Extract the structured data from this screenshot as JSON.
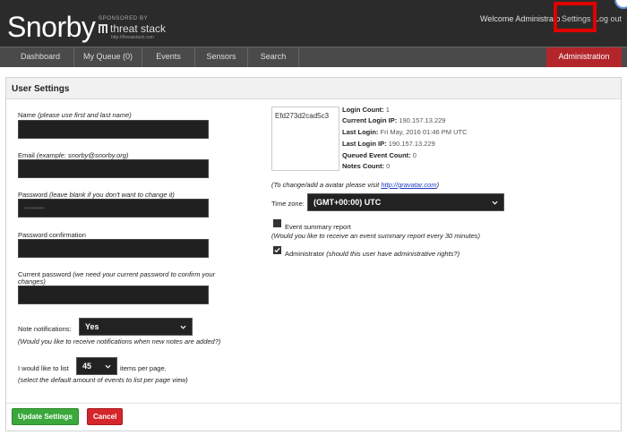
{
  "brand": {
    "logo_text": "Snorby",
    "sponsored_by": "SPONSORED BY",
    "sponsor_name": "threat stack",
    "sponsor_url": "http://threatstack.com"
  },
  "header": {
    "welcome": "Welcome Administrato",
    "settings_label": "Settings",
    "logout_label": "Log out"
  },
  "nav": {
    "items": [
      {
        "label": "Dashboard"
      },
      {
        "label": "My Queue (0)"
      },
      {
        "label": "Events"
      },
      {
        "label": "Sensors"
      },
      {
        "label": "Search"
      }
    ],
    "admin_label": "Administration"
  },
  "panel": {
    "title": "User Settings"
  },
  "form": {
    "name_label": "Name",
    "name_hint": "(please use first and last name)",
    "email_label": "Email",
    "email_hint": "(example: snorby@snorby.org)",
    "password_label": "Password",
    "password_hint": "(leave blank if you don't want to change it)",
    "password_value": "••••••••",
    "password_confirmation_label": "Password confirmation",
    "current_password_label": "Current password",
    "current_password_hint_line1": "(we need your current password to confirm your",
    "current_password_hint_line2": "changes)",
    "note_notifications_label": "Note notifications:",
    "note_notifications_value": "Yes",
    "note_notifications_hint": "(Would you like to receive notifications when new notes are added?)",
    "per_page_prefix": "I would like to list",
    "per_page_value": "45",
    "per_page_suffix": "items per page.",
    "per_page_hint": "(select the default amount of events to list per page view)"
  },
  "profile": {
    "avatar_placeholder": "Efd273d2cad5c3",
    "login_count_label": "Login Count:",
    "login_count_value": "1",
    "current_login_ip_label": "Current Login IP:",
    "current_login_ip_value": "190.157.13.229",
    "last_login_label": "Last Login:",
    "last_login_value": "Fri May, 2016 01:46 PM UTC",
    "last_login_ip_label": "Last Login IP:",
    "last_login_ip_value": "190.157.13.229",
    "queued_event_count_label": "Queued Event Count:",
    "queued_event_count_value": "0",
    "notes_count_label": "Notes Count:",
    "notes_count_value": "0",
    "gravatar_note": "(To change/add a avatar please visit",
    "gravatar_link": "http://gravatar.com",
    "gravatar_note_end": ")",
    "timezone_label": "Time zone:",
    "timezone_value": "(GMT+00:00) UTC",
    "event_summary_label": "Event summary report",
    "event_summary_hint": "(Would you like to receive an event summary report every 30 minutes)",
    "event_summary_checked": false,
    "administrator_label": "Administrator",
    "administrator_hint": "(should this user have administrative rights?)",
    "administrator_checked": true
  },
  "actions": {
    "update_label": "Update Settings",
    "cancel_label": "Cancel"
  },
  "colors": {
    "topbar": "#2b2b2b",
    "navbar": "#4a4a4a",
    "admin_tab": "#b2262b",
    "update_button": "#3aa83a",
    "cancel_button": "#d4262b",
    "highlight": "#e00000"
  }
}
